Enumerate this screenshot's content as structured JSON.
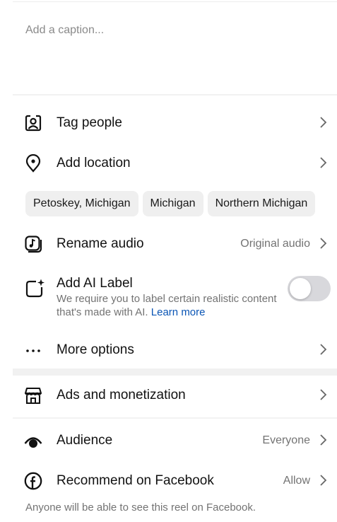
{
  "caption": {
    "placeholder": "Add a caption..."
  },
  "tag_people": {
    "label": "Tag people",
    "icon": "tag-person-icon"
  },
  "add_location": {
    "label": "Add location",
    "icon": "location-pin-icon"
  },
  "location_suggestions": [
    "Petoskey, Michigan",
    "Michigan",
    "Northern Michigan"
  ],
  "rename_audio": {
    "label": "Rename audio",
    "value": "Original audio",
    "icon": "music-note-icon"
  },
  "ai_label": {
    "title": "Add AI Label",
    "description": "We require you to label certain realistic content that's made with AI.",
    "link": "Learn more",
    "enabled": false,
    "icon": "sparkle-square-icon"
  },
  "more_options": {
    "label": "More options",
    "icon": "ellipsis-icon"
  },
  "ads": {
    "label": "Ads and monetization",
    "icon": "storefront-icon"
  },
  "audience": {
    "label": "Audience",
    "value": "Everyone",
    "icon": "eye-icon"
  },
  "facebook": {
    "label": "Recommend on Facebook",
    "value": "Allow",
    "icon": "facebook-icon"
  },
  "facebook_note": "Anyone will be able to see this reel on Facebook.",
  "colors": {
    "link": "#0a55b5",
    "secondary_text": "#737373",
    "toggle_off": "#d8d8dc"
  }
}
